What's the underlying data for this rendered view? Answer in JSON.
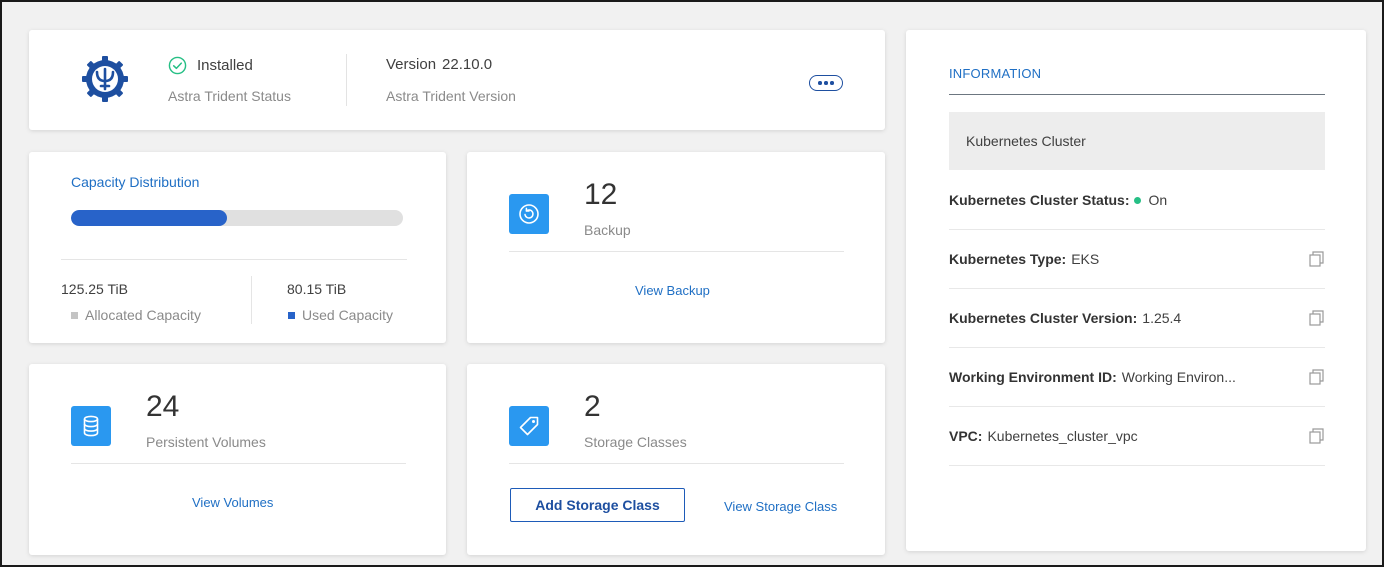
{
  "status_card": {
    "status_value": "Installed",
    "status_label": "Astra Trident Status",
    "version_prefix": "Version",
    "version_value": "22.10.0",
    "version_label": "Astra Trident Version"
  },
  "capacity": {
    "title": "Capacity Distribution",
    "used_fraction": 0.47,
    "allocated_value": "125.25 TiB",
    "allocated_label": "Allocated Capacity",
    "used_value": "80.15 TiB",
    "used_label": "Used Capacity",
    "colors": {
      "used": "#2863c9",
      "allocated": "#c4c4c4"
    }
  },
  "backup": {
    "count": "12",
    "label": "Backup",
    "link": "View Backup",
    "icon": "backup-icon"
  },
  "volumes": {
    "count": "24",
    "label": "Persistent Volumes",
    "link": "View Volumes",
    "icon": "database-icon"
  },
  "storage": {
    "count": "2",
    "label": "Storage Classes",
    "add_button": "Add Storage Class",
    "link": "View Storage Class",
    "icon": "tag-icon"
  },
  "info": {
    "title": "INFORMATION",
    "section": "Kubernetes Cluster",
    "rows": [
      {
        "key": "Kubernetes Cluster Status:",
        "value": "On",
        "copy": false
      },
      {
        "key": "Kubernetes Type:",
        "value": "EKS",
        "copy": true
      },
      {
        "key": "Kubernetes Cluster Version:",
        "value": "1.25.4",
        "copy": true
      },
      {
        "key": "Working Environment ID:",
        "value": "Working Environ...",
        "copy": true
      },
      {
        "key": "VPC:",
        "value": "Kubernetes_cluster_vpc",
        "copy": true
      }
    ]
  },
  "colors": {
    "accent": "#1f6fc4",
    "tile": "#2a98f0",
    "status_on": "#26bf85"
  }
}
